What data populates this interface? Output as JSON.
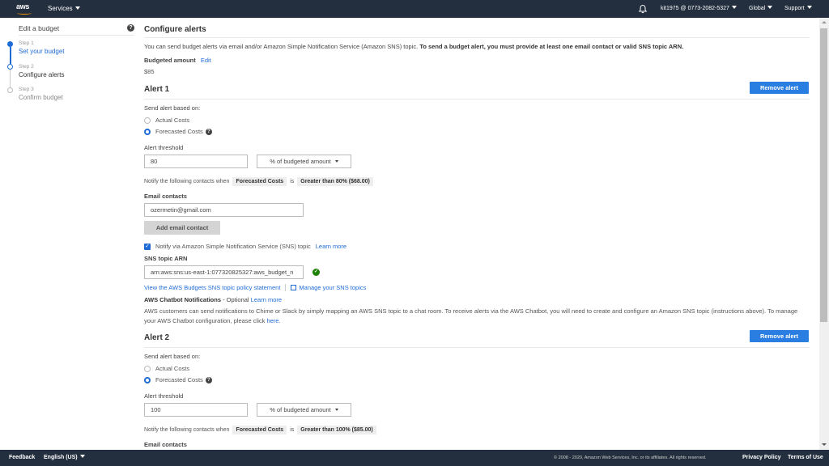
{
  "topnav": {
    "logo": "aws",
    "services": "Services",
    "bell_icon": "notification-bell-icon",
    "account": "kit1975 @ 0773-2082-5327",
    "region": "Global",
    "support": "Support"
  },
  "sidebar": {
    "title": "Edit a budget",
    "help_icon": "?",
    "steps": [
      {
        "number": "Step 1",
        "label": "Set your budget",
        "state": "completed"
      },
      {
        "number": "Step 2",
        "label": "Configure alerts",
        "state": "current"
      },
      {
        "number": "Step 3",
        "label": "Confirm budget",
        "state": "pending"
      }
    ]
  },
  "main": {
    "title": "Configure alerts",
    "intro_plain": "You can send budget alerts via email and/or Amazon Simple Notification Service (Amazon SNS) topic. ",
    "intro_bold": "To send a budget alert, you must provide at least one email contact or valid SNS topic ARN.",
    "budgeted_amount_label": "Budgeted amount",
    "edit_link": "Edit",
    "budgeted_amount": "$85",
    "alerts": [
      {
        "title": "Alert 1",
        "remove_label": "Remove alert",
        "based_on_label": "Send alert based on:",
        "options": [
          "Actual Costs",
          "Forecasted Costs"
        ],
        "selected": "Forecasted Costs",
        "threshold_label": "Alert threshold",
        "threshold_value": "80",
        "threshold_unit": "% of budgeted amount",
        "notify_prefix": "Notify the following contacts when",
        "notify_cost_type": "Forecasted Costs",
        "notify_is": "is",
        "notify_condition": "Greater than 80% ($68.00)",
        "email_label": "Email contacts",
        "email_value": "ozermetin@gmail.com",
        "add_email_label": "Add email contact",
        "sns_checkbox_label": "Notify via Amazon Simple Notification Service (SNS) topic",
        "sns_checked": true,
        "sns_learn_more": "Learn more",
        "sns_arn_label": "SNS topic ARN",
        "sns_arn_value": "arn:aws:sns:us-east-1:077320825327:aws_budget_n",
        "sns_policy_link": "View the AWS Budgets SNS topic policy statement",
        "sns_manage_link": "Manage your SNS topics",
        "chatbot_title": "AWS Chatbot Notifications",
        "chatbot_optional": " - Optional ",
        "chatbot_learn_more": "Learn more",
        "chatbot_text": "AWS customers can send notifications to Chime or Slack by simply mapping an AWS SNS topic to a chat room. To receive alerts via the AWS Chatbot, you will need to create and configure an Amazon SNS topic (instructions above). To manage your AWS Chatbot configuration, please click ",
        "chatbot_here": "here",
        "chatbot_end": "."
      },
      {
        "title": "Alert 2",
        "remove_label": "Remove alert",
        "based_on_label": "Send alert based on:",
        "options": [
          "Actual Costs",
          "Forecasted Costs"
        ],
        "selected": "Forecasted Costs",
        "threshold_label": "Alert threshold",
        "threshold_value": "100",
        "threshold_unit": "% of budgeted amount",
        "notify_prefix": "Notify the following contacts when",
        "notify_cost_type": "Forecasted Costs",
        "notify_is": "is",
        "notify_condition": "Greater than 100% ($85.00)",
        "email_label": "Email contacts"
      }
    ]
  },
  "footer": {
    "feedback": "Feedback",
    "language": "English (US)",
    "copyright": "© 2008 - 2020, Amazon Web Services, Inc. or its affiliates. All rights reserved.",
    "privacy": "Privacy Policy",
    "terms": "Terms of Use"
  },
  "colors": {
    "nav_bg": "#232f3e",
    "accent": "#1f6bd5",
    "button_primary": "#2a7de1",
    "success": "#1d8102"
  }
}
